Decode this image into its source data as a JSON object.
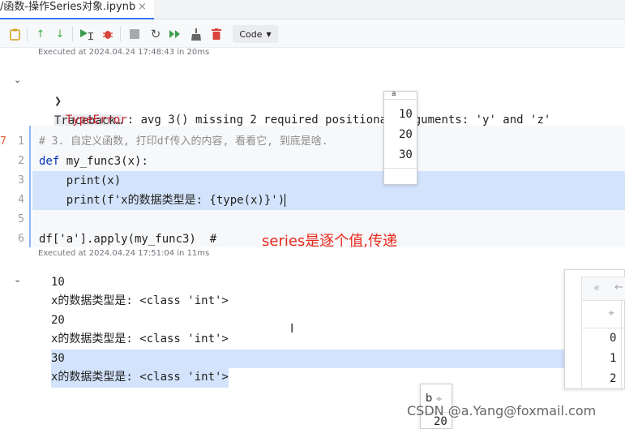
{
  "tab": {
    "title": "/函数-操作Series对象.ipynb",
    "close": "×"
  },
  "toolbar": {
    "icons": [
      "clipboard-icon",
      "arrow-up-icon",
      "arrow-down-icon",
      "run-cursor-icon",
      "debug-icon",
      "stop-icon",
      "restart-icon",
      "run-all-icon",
      "clear-icon",
      "delete-icon"
    ],
    "code_label": "Code",
    "dropdown_arrow": "▼"
  },
  "cell1": {
    "executed": "Executed at 2024.04.24 17:48:43 in 20ms",
    "traceback": "Traceback…",
    "error_name": "TypeError",
    "error_msg": ": avg_3() missing 2 required positional arguments: 'y' and 'z'"
  },
  "cell2": {
    "execution_marker": "7",
    "line_numbers": [
      "1",
      "2",
      "3",
      "4",
      "5",
      "6"
    ],
    "comment": "# 3. 自定义函数, 打印df传入的内容, 看看它, 到底是啥.",
    "kw_def": "def",
    "def_rest": " my_func3(x):",
    "line3": "    print(x)",
    "line4": "    print(f'x的数据类型是: {type(x)}')",
    "line6": "df['a'].apply(my_func3)  #",
    "executed": "Executed at 2024.04.24 17:51:04 in 11ms"
  },
  "annotation": "series是逐个值,传递",
  "output": {
    "lines": [
      "10",
      "x的数据类型是: <class 'int'>",
      "20",
      "x的数据类型是: <class 'int'>",
      "30",
      "x的数据类型是: <class 'int'>"
    ]
  },
  "popup_a": {
    "header": "a",
    "values": [
      "10",
      "20",
      "30"
    ]
  },
  "popup_b": {
    "header": "b",
    "sort": "÷",
    "value": "20"
  },
  "df_panel": {
    "nav_first": "«",
    "nav_prev": "←",
    "sort": "÷",
    "index": [
      "0",
      "1",
      "2"
    ]
  },
  "watermark": "CSDN @a.Yang@foxmail.com"
}
